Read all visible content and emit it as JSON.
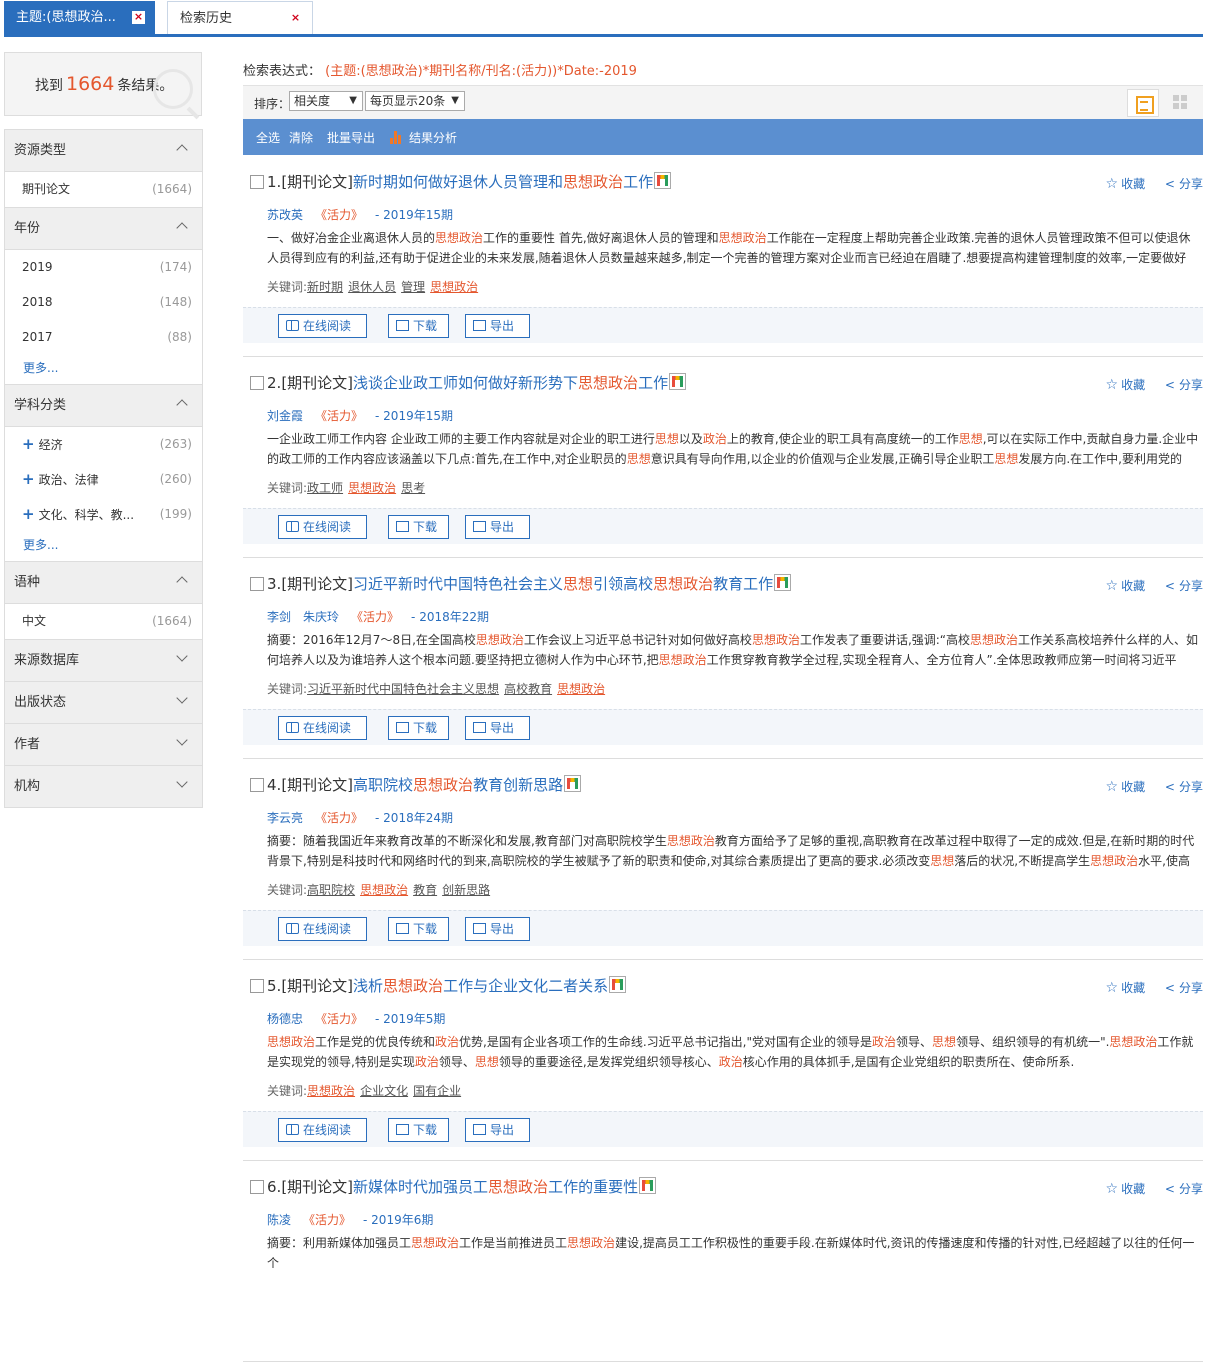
{
  "tabs": [
    {
      "label": "主题:(思想政治...",
      "close": "×"
    },
    {
      "label": "检索历史",
      "close": "×"
    }
  ],
  "result_count": {
    "prefix": "找到",
    "count": "1664",
    "suffix": "条结果。"
  },
  "filters": {
    "resource_type": {
      "title": "资源类型",
      "items": [
        {
          "label": "期刊论文",
          "count": "(1664)"
        }
      ]
    },
    "year": {
      "title": "年份",
      "items": [
        {
          "label": "2019",
          "count": "(174)"
        },
        {
          "label": "2018",
          "count": "(148)"
        },
        {
          "label": "2017",
          "count": "(88)"
        }
      ],
      "more": "更多..."
    },
    "subject": {
      "title": "学科分类",
      "items": [
        {
          "label": "经济",
          "count": "(263)"
        },
        {
          "label": "政治、法律",
          "count": "(260)"
        },
        {
          "label": "文化、科学、教...",
          "count": "(199)"
        }
      ],
      "more": "更多..."
    },
    "language": {
      "title": "语种",
      "items": [
        {
          "label": "中文",
          "count": "(1664)"
        }
      ]
    },
    "source_db": {
      "title": "来源数据库"
    },
    "pub_status": {
      "title": "出版状态"
    },
    "author": {
      "title": "作者"
    },
    "org": {
      "title": "机构"
    }
  },
  "query": {
    "label": "检索表达式：",
    "expression": "(主题:(思想政治)*期刊名称/刊名:(活力))*Date:-2019"
  },
  "sort": {
    "label": "排序：",
    "order": "相关度",
    "page_size": "每页显示20条"
  },
  "actions": {
    "select_all": "全选",
    "clear": "清除",
    "batch_export": "批量导出",
    "analysis": "结果分析"
  },
  "buttons": {
    "read": "在线阅读",
    "download": "下载",
    "export": "导出",
    "collect": "收藏",
    "share": "分享",
    "kw_label": "关键词:"
  },
  "results": [
    {
      "num": "1.",
      "type": "[期刊论文]",
      "title_parts": [
        "新时期如何做好退休人员管理和",
        "思想政治",
        "工作"
      ],
      "authors": [
        "苏改英"
      ],
      "journal": "《活力》",
      "issue": "- 2019年15期",
      "abstract_parts": [
        "一、做好冶金企业离退休人员的",
        "思想政治",
        "工作的重要性 首先,做好离退休人员的管理和",
        "思想政治",
        "工作能在一定程度上帮助完善企业政策.完善的退休人员管理政策不但可以使退休人员得到应有的利益,还有助于促进企业的未来发展,随着退休人员数量越来越多,制定一个完善的管理方案对企业而言已经迫在眉睫了.想要提高构建管理制度的效率,一定要做好退...",
        "",
        ""
      ],
      "keywords": [
        "新时期",
        "退休人员",
        "管理",
        "思想政治"
      ]
    },
    {
      "num": "2.",
      "type": "[期刊论文]",
      "title_parts": [
        "浅谈企业政工师如何做好新形势下",
        "思想政治",
        "工作"
      ],
      "authors": [
        "刘金霞"
      ],
      "journal": "《活力》",
      "issue": "- 2019年15期",
      "abstract_parts": [
        "一企业政工师工作内容 企业政工师的主要工作内容就是对企业的职工进行",
        "思想",
        "以及",
        "政治",
        "上的教育,使企业的职工具有高度统一的工作",
        "思想",
        ",可以在实际工作中,贡献自身力量.企业中的政工师的工作内容应该涵盖以下几点:首先,在工作中,对企业职员的",
        "思想",
        "意识具有导向作用,以企业的价值观与企业发展,正确引导企业职工",
        "思想",
        "发展方向.在工作中,要利用党的方..."
      ],
      "keywords": [
        "政工师",
        "思想政治",
        "思考"
      ]
    },
    {
      "num": "3.",
      "type": "[期刊论文]",
      "title_parts": [
        "习近平新时代中国特色社会主义",
        "思想",
        "引领高校",
        "思想政治",
        "教育工作"
      ],
      "authors": [
        "李剑",
        "朱庆玲"
      ],
      "journal": "《活力》",
      "issue": "- 2018年22期",
      "abstract_parts": [
        "摘要：2016年12月7～8日,在全国高校",
        "思想政治",
        "工作会议上习近平总书记针对如何做好高校",
        "思想政治",
        "工作发表了重要讲话,强调:“高校",
        "思想政治",
        "工作关系高校培养什么样的人、如何培养人以及为谁培养人这个根本问题.要坚持把立德树人作为中心环节,把",
        "思想政治",
        "工作贯穿教育教学全过程,实现全程育人、全方位育人”.全体思政教师应第一时间将习近平新..."
      ],
      "keywords": [
        "习近平新时代中国特色社会主义思想",
        "高校教育",
        "思想政治"
      ]
    },
    {
      "num": "4.",
      "type": "[期刊论文]",
      "title_parts": [
        "高职院校",
        "思想政治",
        "教育创新思路"
      ],
      "authors": [
        "李云亮"
      ],
      "journal": "《活力》",
      "issue": "- 2018年24期",
      "abstract_parts": [
        "摘要：随着我国近年来教育改革的不断深化和发展,教育部门对高职院校学生",
        "思想政治",
        "教育方面给予了足够的重视,高职教育在改革过程中取得了一定的成效.但是,在新时期的时代背景下,特别是科技时代和网络时代的到来,高职院校的学生被赋予了新的职责和使命,对其综合素质提出了更高的要求.必须改变",
        "思想",
        "落后的状况,不断提高学生",
        "思想政治",
        "水平,使高职..."
      ],
      "keywords": [
        "高职院校",
        "思想政治",
        "教育",
        "创新思路"
      ]
    },
    {
      "num": "5.",
      "type": "[期刊论文]",
      "title_parts": [
        "浅析",
        "思想政治",
        "工作与企业文化二者关系"
      ],
      "authors": [
        "杨德忠"
      ],
      "journal": "《活力》",
      "issue": "- 2019年5期",
      "abstract_parts": [
        "",
        "思想政治",
        "工作是党的优良传统和",
        "政治",
        "优势,是国有企业各项工作的生命线.习近平总书记指出,\"党对国有企业的领导是",
        "政治",
        "领导、",
        "思想",
        "领导、组织领导的有机统一\".",
        "思想政治",
        "工作就是实现党的领导,特别是实现",
        "政治",
        "领导、",
        "思想",
        "领导的重要途径,是发挥党组织领导核心、",
        "政治",
        "核心作用的具体抓手,是国有企业党组织的职责所在、使命所系."
      ],
      "keywords": [
        "思想政治",
        "企业文化",
        "国有企业"
      ]
    },
    {
      "num": "6.",
      "type": "[期刊论文]",
      "title_parts": [
        "新媒体时代加强员工",
        "思想政治",
        "工作的重要性"
      ],
      "authors": [
        "陈凌"
      ],
      "journal": "《活力》",
      "issue": "- 2019年6期",
      "abstract_parts": [
        "摘要：利用新媒体加强员工",
        "思想政治",
        "工作是当前推进员工",
        "思想政治",
        "建设,提高员工工作积极性的重要手段.在新媒体时代,资讯的传播速度和传播的针对性,已经超越了以往的任何一个"
      ],
      "keywords": []
    }
  ],
  "colors": {
    "accent": "#2a6ebd",
    "highlight": "#e4572e",
    "actionbar": "#5b8fd0"
  },
  "icons": [
    "search-icon",
    "star-icon",
    "share-icon",
    "book-icon",
    "download-icon",
    "export-icon",
    "bar-chart-icon",
    "list-view-icon",
    "grid-view-icon",
    "chevron-up-icon",
    "chevron-down-icon",
    "plus-icon",
    "close-icon"
  ]
}
